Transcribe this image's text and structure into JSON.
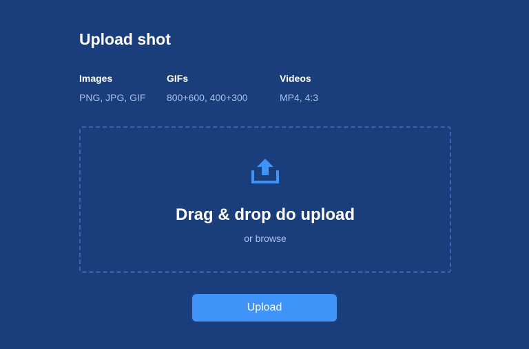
{
  "header": {
    "title": "Upload shot"
  },
  "formats": [
    {
      "label": "Images",
      "value": "PNG, JPG, GIF"
    },
    {
      "label": "GIFs",
      "value": "800+600, 400+300"
    },
    {
      "label": "Videos",
      "value": "MP4, 4:3"
    }
  ],
  "dropzone": {
    "icon": "upload-icon",
    "title": "Drag & drop do upload",
    "subtitle": "or browse"
  },
  "actions": {
    "upload_label": "Upload"
  },
  "colors": {
    "background": "#1a3d7c",
    "accent": "#4194f7",
    "muted_text": "#a9c3ef",
    "dash_border": "#3767b3"
  }
}
